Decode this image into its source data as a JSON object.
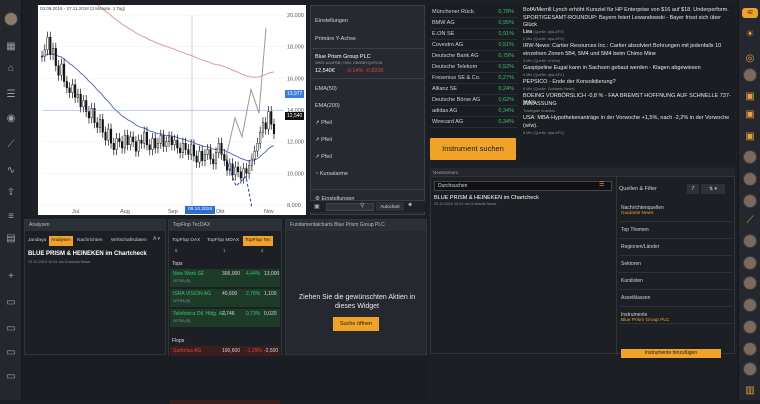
{
  "chart": {
    "header": "03.09.2018 - 27.11.2018 (3 Monate, 1 Tag)",
    "y_ticks": [
      "20,000",
      "18,000",
      "16,000",
      "14,000",
      "12,000",
      "10,000",
      "8,000"
    ],
    "x_ticks": [
      "Jul",
      "Aug",
      "Sep",
      "Okt",
      "Nov"
    ],
    "x_cursor_label": "09.10.2018",
    "price_label_1": "13,977",
    "price_label_2": "12,540",
    "close_series": [
      17.4,
      17.8,
      18.6,
      17.5,
      17.9,
      16.8,
      16.2,
      16.9,
      15.8,
      15.4,
      15.1,
      15.6,
      14.8,
      15.0,
      14.2,
      14.6,
      13.9,
      13.5,
      14.1,
      13.2,
      12.9,
      13.4,
      12.6,
      12.1,
      12.8,
      11.9,
      11.5,
      12.2,
      12.0,
      11.6,
      12.4,
      11.8,
      12.3,
      12.0,
      11.4,
      12.1,
      11.9,
      12.6,
      11.8,
      11.5,
      12.2,
      11.6,
      11.9,
      12.4,
      11.7,
      12.0,
      12.3,
      11.8,
      12.1,
      11.6,
      11.3,
      11.9,
      11.5,
      11.2,
      11.8,
      11.1,
      10.7,
      11.4,
      10.8,
      11.2,
      11.5,
      10.9,
      10.6,
      11.3,
      11.9,
      11.2,
      10.8,
      10.2,
      10.6,
      9.9,
      10.4,
      10.1,
      9.7,
      10.3,
      10.0,
      10.5,
      10.9,
      11.4,
      11.9,
      12.6,
      13.2,
      12.8,
      13.9,
      13.1,
      12.5
    ],
    "toolbar": {
      "autochart": "Autochart"
    }
  },
  "context_menu": {
    "items": [
      "Einstellungen",
      "Primäre Y-Achse"
    ],
    "instrument_name": "Blue Prism Group PLC",
    "instrument_meta": "WKN: A2AFBB | ISIN: GB00BYQ0HV16",
    "instrument_quote": "12,540€",
    "instrument_change": "-0,14%  -0,820€",
    "more_items": [
      "EMA(50)",
      "EMA(200)",
      "Pfeil",
      "Pfeil",
      "Pfeil",
      "Kursalarme"
    ],
    "footer": "Einstellungen"
  },
  "quotes": [
    {
      "name": "Münchener Rück.",
      "val": "0,78%"
    },
    {
      "name": "BMW AG",
      "val": "0,95%"
    },
    {
      "name": "E.ON SE",
      "val": "0,91%"
    },
    {
      "name": "Covestro AG",
      "val": "0,51%"
    },
    {
      "name": "Deutsche Bank AG",
      "val": "0,79%"
    },
    {
      "name": "Deutsche Telekom",
      "val": "0,52%"
    },
    {
      "name": "Fresenius SE & Co.",
      "val": "0,27%"
    },
    {
      "name": "Allianz SE",
      "val": "0,24%"
    },
    {
      "name": "Deutsche Börse AG",
      "val": "0,62%"
    },
    {
      "name": "adidas AG",
      "val": "0,34%"
    },
    {
      "name": "Wirecard AG",
      "val": "0,34%"
    }
  ],
  "search_button": "Instrument suchen",
  "news": [
    {
      "h": "BofA/Merrill Lynch erhöht Kursziel für HP Enterprise von $16 auf $18. Underperform.",
      "m": ""
    },
    {
      "h": "SPORT/GESAMT-ROUNDUP: Bayern feiert Lewandowski - Bayer frisst sich über Glück",
      "m": "5 Min (Quelle: dpa-AFX)"
    },
    {
      "h": "Lira",
      "m": "2 Min (Quelle: dpa-AFX)"
    },
    {
      "h": "IRW-News: Cartier Resources Inc.: Cartier absolviert Bohrungen mit jedenfalls 10",
      "m": ""
    },
    {
      "h": "einzelnen Zonen 5B4, 5M4 und 5M4 beim Chimo Mine",
      "m": "5 Min (Quelle: Ir-Wire)"
    },
    {
      "h": "Gaspipeline Eugal kann in Sachsen gebaut werden - Klagen abgewiesen",
      "m": "6 Min (Quelle: dpa-AFX)"
    },
    {
      "h": "PEPSICO - Ende der Konsolidierung?",
      "m": "6 Min (Quelle: Guidants News)"
    },
    {
      "h": "BOEING VORBÖRSLICH -0,8 % - FAA BREMST HOFFNUNG AUF SCHNELLE 737-MAX-",
      "m": ""
    },
    {
      "h": "ZULASSUNG",
      "m": "Tradegate Ausblick"
    },
    {
      "h": "USA: MBA-Hypothekenanträge in der Vorwoche +1,5%, nach -2,2% in der Vorwoche",
      "m": ""
    },
    {
      "h": "(w/w).",
      "m": "8 Min (Quelle: dpa-AFX)"
    }
  ],
  "newsstream": {
    "title": "Newsstream",
    "search_value": "Durchsuchen",
    "item_headline": "BLUE PRISM & HEINEKEN im Chartcheck",
    "item_meta": "23.10.2019 10:51 via Guidants News",
    "filter_title": "Quellen & Filter",
    "filter_badge": "7",
    "filters": [
      "Nachrichtenquellen",
      "Guidants News",
      "Top Themen",
      "Regionen/Länder",
      "Sektoren",
      "Kurslisten",
      "Assetklassen",
      "Instrumente",
      "Blue Prism Group PLC"
    ],
    "add_button": "Instrumente hinzufügen"
  },
  "analysen": {
    "title": "Analysen",
    "tabs": [
      "Jandaya",
      "Analysen",
      "Nachrichten",
      "Wirtschaftsdaten"
    ],
    "headline": "BLUE PRISM & HEINEKEN im Chartcheck",
    "meta": "23.10.2019 10:51 via Guidants News"
  },
  "topflop": {
    "title": "TopFlop TecDAX",
    "tabs": [
      "TopFlop DAX",
      "TopFlop MDAX",
      "TopFlop Tec"
    ],
    "subheader": [
      "5",
      "1",
      "2"
    ],
    "tops_label": "Tops",
    "flops_label": "Flops",
    "tops": [
      {
        "n": "New Work SE",
        "s": "XETRA (R)",
        "p": "306,000",
        "c": "4,44%",
        "v": "13,000"
      },
      {
        "n": "ISRA VISION AG",
        "s": "XETRA (R)",
        "p": "40,600",
        "c": "2,78%",
        "v": "1,100"
      },
      {
        "n": "Telefónica Dtl. Hldg. AG",
        "s": "XETRA (R)",
        "p": "2,746",
        "c": "0,73%",
        "v": "0,020"
      }
    ],
    "flops": [
      {
        "n": "Sartorius AG",
        "s": "XETRA (R)",
        "p": "190,600",
        "c": "-1,29%",
        "v": "-2,500"
      },
      {
        "n": "RIB Software SE",
        "s": "XETRA (R)",
        "p": "24,620",
        "c": "-1,07%",
        "v": "-0,260"
      },
      {
        "n": "1&1 Drillisch AG",
        "s": "XETRA (R)",
        "p": "24,900",
        "c": "-1,07%",
        "v": "-0,280"
      }
    ]
  },
  "fundamentals": {
    "title": "Fundamentalcharts Blue Prism Group PLC",
    "prompt": "Ziehen Sie die gewünschten Aktien in dieses Widget",
    "button": "Suche öffnen"
  },
  "colors": {
    "accent": "#f0a327",
    "up": "#39c46a",
    "down": "#e0453a"
  }
}
